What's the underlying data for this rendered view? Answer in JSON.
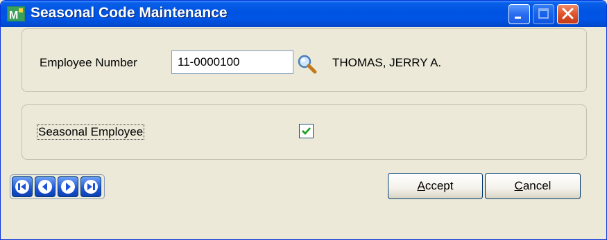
{
  "window": {
    "title": "Seasonal Code Maintenance",
    "icons": {
      "app": "sage-app-icon",
      "minimize": "minimize-icon",
      "maximize": "maximize-icon",
      "close": "close-icon"
    }
  },
  "employee": {
    "label": "Employee Number",
    "number": "11-0000100",
    "lookup_icon": "magnifier-icon",
    "name": "THOMAS, JERRY A."
  },
  "seasonal": {
    "label": "Seasonal Employee",
    "checked": true
  },
  "navigation": {
    "icons": [
      "first-record-icon",
      "previous-record-icon",
      "next-record-icon",
      "last-record-icon"
    ]
  },
  "buttons": {
    "accept_mnemonic": "A",
    "accept_rest": "ccept",
    "cancel_mnemonic": "C",
    "cancel_rest": "ancel"
  },
  "colors": {
    "title_bar": "#0054e3",
    "close_button": "#e0542b",
    "nav_button": "#1b54d6",
    "check_mark": "#21a121"
  }
}
